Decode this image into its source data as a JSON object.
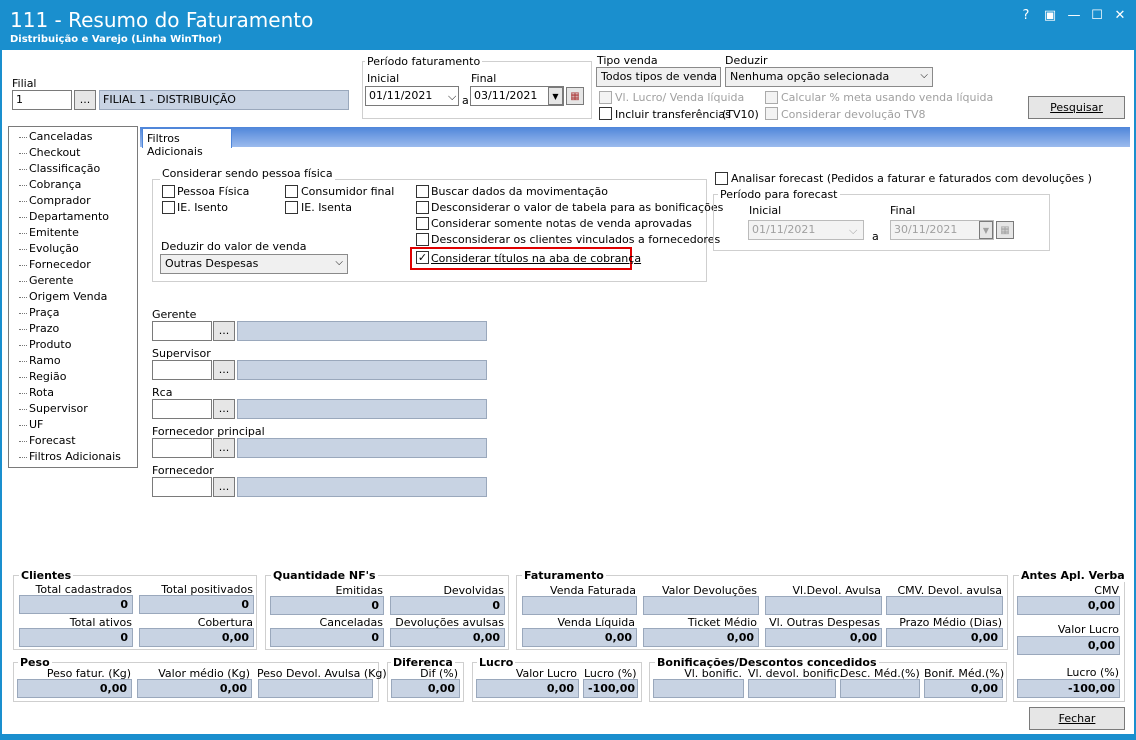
{
  "window": {
    "title": "111 - Resumo do Faturamento",
    "subtitle": "Distribuição e Varejo (Linha WinThor)",
    "controls": [
      "?",
      "▣",
      "—",
      "☐",
      "✕"
    ]
  },
  "filial": {
    "label": "Filial",
    "code": "1",
    "btn": "...",
    "name": "FILIAL 1 - DISTRIBUIÇÃO"
  },
  "periodo": {
    "title": "Período faturamento",
    "inicial_label": "Inicial",
    "inicial": "01/11/2021",
    "a": "a",
    "final_label": "Final",
    "final": "03/11/2021"
  },
  "tipo_venda": {
    "label": "Tipo venda",
    "value": "Todos tipos de venda"
  },
  "deduzir": {
    "label": "Deduzir",
    "value": "Nenhuma opção selecionada"
  },
  "opts": {
    "vl_lucro": "Vl. Lucro/ Venda líquida",
    "calcular": "Calcular % meta usando venda líquida",
    "incluir": "Incluir transferências",
    "incluir_tag": "(TV10)",
    "considerar_dev": "Considerar devolução TV8"
  },
  "pesquisar": "Pesquisar",
  "tree": [
    "Canceladas",
    "Checkout",
    "Classificação",
    "Cobrança",
    "Comprador",
    "Departamento",
    "Emitente",
    "Evolução",
    "Fornecedor",
    "Gerente",
    "Origem Venda",
    "Praça",
    "Prazo",
    "Produto",
    "Ramo",
    "Região",
    "Rota",
    "Supervisor",
    "UF",
    "Forecast",
    "Filtros Adicionais"
  ],
  "tab": "Filtros Adicionais",
  "pf": {
    "title": "Considerar sendo pessoa física",
    "pessoa_fisica": "Pessoa Física",
    "consumidor_final": "Consumidor final",
    "ie_isento": "IE. Isento",
    "ie_isenta": "IE. Isenta",
    "deduzir_label": "Deduzir do valor de venda",
    "deduzir_value": "Outras Despesas"
  },
  "checks": {
    "buscar": "Buscar dados da movimentação",
    "desc_tabela": "Desconsiderar o valor de tabela para as bonificações",
    "somente_notas": "Considerar somente notas de venda aprovadas",
    "desc_clientes": "Desconsiderar os clientes vinculados a fornecedores",
    "titulos": "Considerar títulos na aba de cobrança"
  },
  "forecast": {
    "analisar": "Analisar forecast (Pedidos a faturar e faturados com devoluções )",
    "periodo": "Período para forecast",
    "inicial_label": "Inicial",
    "inicial": "01/11/2021",
    "a": "a",
    "final_label": "Final",
    "final": "30/11/2021"
  },
  "lookups": [
    {
      "label": "Gerente",
      "btn": "..."
    },
    {
      "label": "Supervisor",
      "btn": "..."
    },
    {
      "label": "Rca",
      "btn": "..."
    },
    {
      "label": "Fornecedor principal",
      "btn": "..."
    },
    {
      "label": "Fornecedor",
      "btn": "..."
    }
  ],
  "clientes": {
    "title": "Clientes",
    "total_cadastrados": "Total cadastrados",
    "v1": "0",
    "total_positivados": "Total positivados",
    "v2": "0",
    "total_ativos": "Total ativos",
    "v3": "0",
    "cobertura": "Cobertura",
    "v4": "0,00"
  },
  "nfs": {
    "title": "Quantidade NF's",
    "emitidas": "Emitidas",
    "v1": "0",
    "devolvidas": "Devolvidas",
    "v2": "0",
    "canceladas": "Canceladas",
    "v3": "0",
    "dev_avulsas": "Devoluções avulsas",
    "v4": "0,00"
  },
  "fat": {
    "title": "Faturamento",
    "venda_faturada": "Venda Faturada",
    "valor_devolucoes": "Valor Devoluções",
    "vl_devol_avulsa": "Vl.Devol. Avulsa",
    "cmv_devol": "CMV. Devol. avulsa",
    "venda_liquida": "Venda Líquida",
    "vl": "0,00",
    "ticket": "Ticket Médio",
    "tm": "0,00",
    "outras": "Vl. Outras Despesas",
    "od": "0,00",
    "prazo": "Prazo Médio (Dias)",
    "pm": "0,00"
  },
  "antes": {
    "title": "Antes Apl. Verba",
    "cmv": "CMV",
    "v1": "0,00",
    "valor_lucro": "Valor Lucro",
    "v2": "0,00",
    "lucro_pct": "Lucro (%)",
    "v3": "-100,00"
  },
  "peso": {
    "title": "Peso",
    "peso_fatur": "Peso fatur. (Kg)",
    "v1": "0,00",
    "valor_medio": "Valor médio (Kg)",
    "v2": "0,00",
    "peso_devol": "Peso Devol. Avulsa (Kg)"
  },
  "diferenca": {
    "title": "Diferenca",
    "dif": "Dif (%)",
    "v": "0,00"
  },
  "lucro": {
    "title": "Lucro",
    "valor": "Valor Lucro",
    "v1": "0,00",
    "pct": "Lucro (%)",
    "v2": "-100,00"
  },
  "bonif": {
    "title": "Bonificações/Descontos concedidos",
    "vl": "Vl. bonific.",
    "devol": "Vl. devol. bonific.",
    "desc": "Desc. Méd.(%)",
    "bonif_med": "Bonif. Méd.(%)",
    "v": "0,00"
  },
  "fechar": "Fechar"
}
